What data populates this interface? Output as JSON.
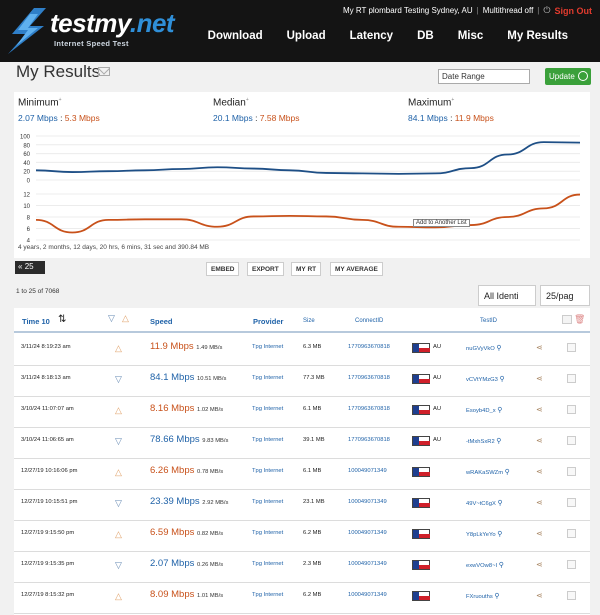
{
  "brand": {
    "logo_main": "testmy",
    "logo_tld": ".net",
    "logo_sub": "Internet Speed Test"
  },
  "status": {
    "location": "My RT plombard Testing Sydney, AU",
    "mode": "Multithread off",
    "signout": "Sign Out"
  },
  "nav": {
    "items": [
      "Download",
      "Upload",
      "Latency",
      "DB",
      "Misc",
      "My Results"
    ]
  },
  "page": {
    "title": "My Results",
    "date_range_placeholder": "Date Range",
    "update_label": "Update"
  },
  "summary": {
    "minimum": {
      "label": "Minimum",
      "download": "2.07 Mbps",
      "upload": "5.3 Mbps"
    },
    "median": {
      "label": "Median",
      "download": "20.1 Mbps",
      "upload": "7.58 Mbps"
    },
    "maximum": {
      "label": "Maximum",
      "download": "84.1 Mbps",
      "upload": "11.9 Mbps"
    }
  },
  "chart_data": {
    "type": "line",
    "download": {
      "yticks": [
        100,
        80,
        60,
        40,
        20,
        0
      ],
      "ylim": [
        0,
        100
      ],
      "values": [
        22,
        18,
        20,
        22,
        25,
        29,
        26,
        22,
        16,
        15,
        14,
        15,
        27,
        58,
        86,
        85
      ]
    },
    "upload": {
      "yticks": [
        12,
        10,
        8,
        6,
        4
      ],
      "ylim": [
        4,
        12
      ],
      "values": [
        7.5,
        5.3,
        7.5,
        7.6,
        7.6,
        6.3,
        8.1,
        8.2,
        8.1,
        7.5,
        6.3,
        6.2,
        6.6,
        8.0,
        9.5,
        11.9
      ]
    },
    "colors": {
      "download": "#1e4f86",
      "upload": "#c8511a"
    }
  },
  "chart_footer": "4 years, 2 months, 12 days, 20 hrs, 6 mins, 31 sec and 390.84 MB",
  "chart_tooltip": "Add to Another List",
  "toolbar": {
    "pager": "25",
    "buttons": [
      "EMBED",
      "EXPORT",
      "MY RT",
      "MY AVERAGE"
    ],
    "count": "1 to 25 of 7068",
    "filter": "All Identi",
    "per_page": "25/pag"
  },
  "table": {
    "headers": {
      "time": "Time 10",
      "speed": "Speed",
      "provider": "Provider",
      "size": "Size",
      "connect_id": "ConnectID",
      "test_id": "TestID"
    },
    "rows": [
      {
        "date": "3/11/24 8:19:23 am",
        "dir": "up",
        "speed": "11.9 Mbps",
        "mbs": "1.49 MB/s",
        "provider": "Tpg Internet",
        "size": "6.3 MB",
        "cid": "1770963670818",
        "cc": "AU",
        "tid": "nuGVyVkO",
        "speed_color": "#c8511a"
      },
      {
        "date": "3/11/24 8:18:13 am",
        "dir": "down",
        "speed": "84.1 Mbps",
        "mbs": "10.51 MB/s",
        "provider": "Tpg Internet",
        "size": "77.3 MB",
        "cid": "1770963670818",
        "cc": "AU",
        "tid": "vCVtYMzG3",
        "speed_color": "#1f62a8"
      },
      {
        "date": "3/10/24 11:07:07 am",
        "dir": "up",
        "speed": "8.16 Mbps",
        "mbs": "1.02 MB/s",
        "provider": "Tpg Internet",
        "size": "6.1 MB",
        "cid": "1770963670818",
        "cc": "AU",
        "tid": "Esoyb4D_x",
        "speed_color": "#c8511a"
      },
      {
        "date": "3/10/24 11:06:65 am",
        "dir": "down",
        "speed": "78.66 Mbps",
        "mbs": "9.83 MB/s",
        "provider": "Tpg Internet",
        "size": "39.1 MB",
        "cid": "1770963670818",
        "cc": "AU",
        "tid": "-tMxhSxR2",
        "speed_color": "#1f62a8"
      },
      {
        "date": "12/27/19 10:16:06 pm",
        "dir": "up",
        "speed": "6.26 Mbps",
        "mbs": "0.78 MB/s",
        "provider": "Tpg Internet",
        "size": "6.1 MB",
        "cid": "100049071349",
        "cc": "",
        "tid": "wRAKaSWZm",
        "speed_color": "#c8511a"
      },
      {
        "date": "12/27/19 10:15:51 pm",
        "dir": "down",
        "speed": "23.39 Mbps",
        "mbs": "2.92 MB/s",
        "provider": "Tpg Internet",
        "size": "23.1 MB",
        "cid": "100049071349",
        "cc": "",
        "tid": "49V~tC6gX",
        "speed_color": "#1f62a8"
      },
      {
        "date": "12/27/19 9:15:50 pm",
        "dir": "up",
        "speed": "6.59 Mbps",
        "mbs": "0.82 MB/s",
        "provider": "Tpg Internet",
        "size": "6.2 MB",
        "cid": "100049071349",
        "cc": "",
        "tid": "Y8pLkYeYo",
        "speed_color": "#c8511a"
      },
      {
        "date": "12/27/19 9:15:35 pm",
        "dir": "down",
        "speed": "2.07 Mbps",
        "mbs": "0.26 MB/s",
        "provider": "Tpg Internet",
        "size": "2.3 MB",
        "cid": "100049071349",
        "cc": "",
        "tid": "exwVOw8~I",
        "speed_color": "#1f62a8"
      },
      {
        "date": "12/27/19 8:15:32 pm",
        "dir": "up",
        "speed": "8.09 Mbps",
        "mbs": "1.01 MB/s",
        "provider": "Tpg Internet",
        "size": "6.2 MB",
        "cid": "100049071349",
        "cc": "",
        "tid": "FXruouths",
        "speed_color": "#c8511a"
      }
    ]
  }
}
